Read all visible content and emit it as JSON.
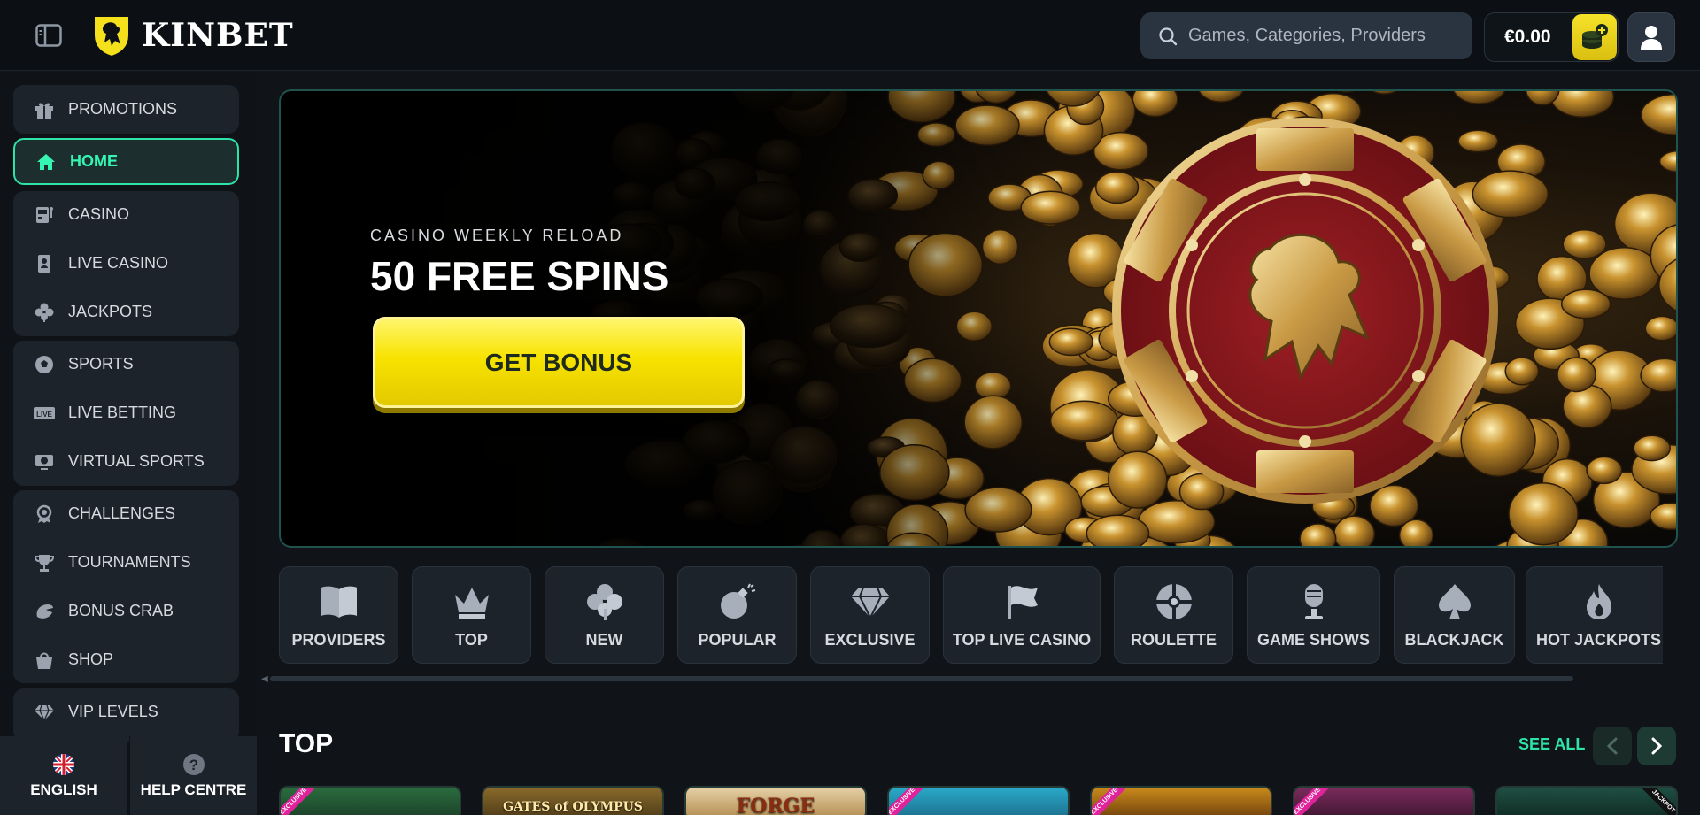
{
  "header": {
    "brand": "KINBET",
    "search_placeholder": "Games, Categories, Providers",
    "balance": "€0.00"
  },
  "sidebar": {
    "items": [
      {
        "label": "PROMOTIONS",
        "icon": "gift-icon"
      },
      {
        "label": "HOME",
        "icon": "home-icon",
        "active": true
      },
      {
        "label": "CASINO",
        "icon": "slot-machine-icon"
      },
      {
        "label": "LIVE CASINO",
        "icon": "live-card-icon"
      },
      {
        "label": "JACKPOTS",
        "icon": "clover-icon"
      },
      {
        "label": "SPORTS",
        "icon": "soccer-ball-icon"
      },
      {
        "label": "LIVE BETTING",
        "icon": "live-badge-icon"
      },
      {
        "label": "VIRTUAL SPORTS",
        "icon": "monitor-ball-icon"
      },
      {
        "label": "CHALLENGES",
        "icon": "badge-icon"
      },
      {
        "label": "TOURNAMENTS",
        "icon": "trophy-icon"
      },
      {
        "label": "BONUS CRAB",
        "icon": "crab-claw-icon"
      },
      {
        "label": "SHOP",
        "icon": "shopping-bag-icon"
      },
      {
        "label": "VIP LEVELS",
        "icon": "diamond-icon"
      }
    ],
    "footer": {
      "language": "ENGLISH",
      "help": "HELP CENTRE"
    }
  },
  "banner": {
    "eyebrow": "CASINO WEEKLY RELOAD",
    "title": "50 FREE SPINS",
    "cta": "GET BONUS"
  },
  "categories": [
    {
      "label": "PROVIDERS",
      "icon": "book-icon"
    },
    {
      "label": "TOP",
      "icon": "crown-icon"
    },
    {
      "label": "NEW",
      "icon": "clover-icon"
    },
    {
      "label": "POPULAR",
      "icon": "bomb-icon"
    },
    {
      "label": "EXCLUSIVE",
      "icon": "diamond-icon"
    },
    {
      "label": "TOP LIVE CASINO",
      "icon": "flag-icon"
    },
    {
      "label": "ROULETTE",
      "icon": "roulette-icon"
    },
    {
      "label": "GAME SHOWS",
      "icon": "microphone-icon"
    },
    {
      "label": "BLACKJACK",
      "icon": "spade-icon"
    },
    {
      "label": "HOT JACKPOTS",
      "icon": "flame-icon"
    }
  ],
  "top_section": {
    "title": "TOP",
    "see_all": "SEE ALL",
    "games": [
      {
        "label": "",
        "ribbon": "EXCLUSIVE"
      },
      {
        "label": "GATES of OLYMPUS",
        "ribbon": ""
      },
      {
        "label": "FORGE",
        "ribbon": ""
      },
      {
        "label": "",
        "ribbon": "EXCLUSIVE"
      },
      {
        "label": "",
        "ribbon": "EXCLUSIVE"
      },
      {
        "label": "",
        "ribbon": "EXCLUSIVE"
      },
      {
        "label": "",
        "ribbon": "JACKPOT"
      }
    ]
  },
  "colors": {
    "accent": "#2ee3a6",
    "cta_yellow": "#f7e300",
    "panel": "#1d232b",
    "background": "#101419"
  }
}
